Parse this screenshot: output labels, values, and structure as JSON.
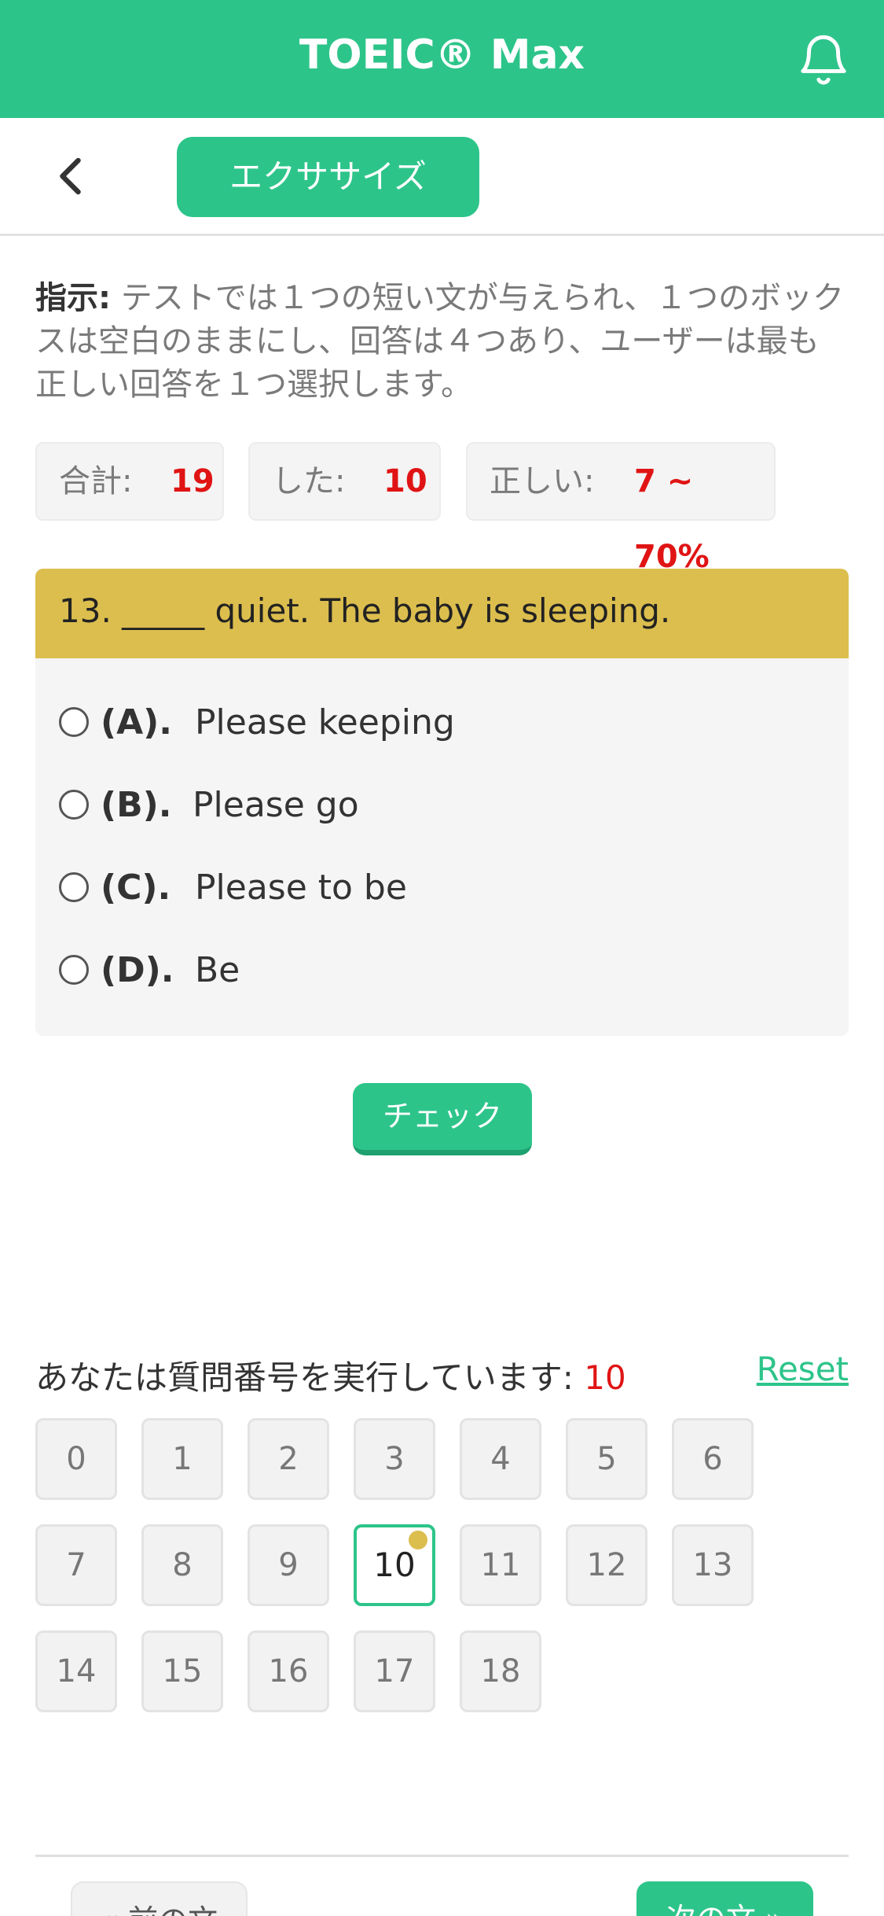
{
  "app": {
    "title": "TOEIC® Max",
    "bell_icon": "bell-icon",
    "accent_color": "#2dc48a"
  },
  "subbar": {
    "back_icon": "chevron-left-icon",
    "exercise_label": "エクササイズ"
  },
  "instructions": {
    "label": "指示:",
    "text": " テストでは１つの短い文が与えられ、１つのボックスは空白のままにし、回答は４つあり、ユーザーは最も正しい回答を１つ選択します。"
  },
  "stats": {
    "total_label": "合計:",
    "total_value": "19",
    "done_label": "した:",
    "done_value": "10",
    "correct_label": "正しい:",
    "correct_value": "7 ~ 70%"
  },
  "question": {
    "text": "13. _____ quiet. The baby is sleeping.",
    "header_color": "#dcbe4e",
    "options": [
      {
        "label": "(A).",
        "text": "Please keeping"
      },
      {
        "label": "(B).",
        "text": "Please go"
      },
      {
        "label": "(C).",
        "text": "Please to be"
      },
      {
        "label": "(D).",
        "text": "Be"
      }
    ]
  },
  "check_label": "チェック",
  "progress": {
    "running_label": "あなたは質問番号を実行しています:",
    "running_value": "10",
    "reset_label": "Reset",
    "numbers": [
      "0",
      "1",
      "2",
      "3",
      "4",
      "5",
      "6",
      "7",
      "8",
      "9",
      "10",
      "11",
      "12",
      "13",
      "14",
      "15",
      "16",
      "17",
      "18"
    ],
    "current": "10"
  },
  "nav": {
    "prev_label": "« 前の文",
    "next_label": "次の文 »"
  }
}
